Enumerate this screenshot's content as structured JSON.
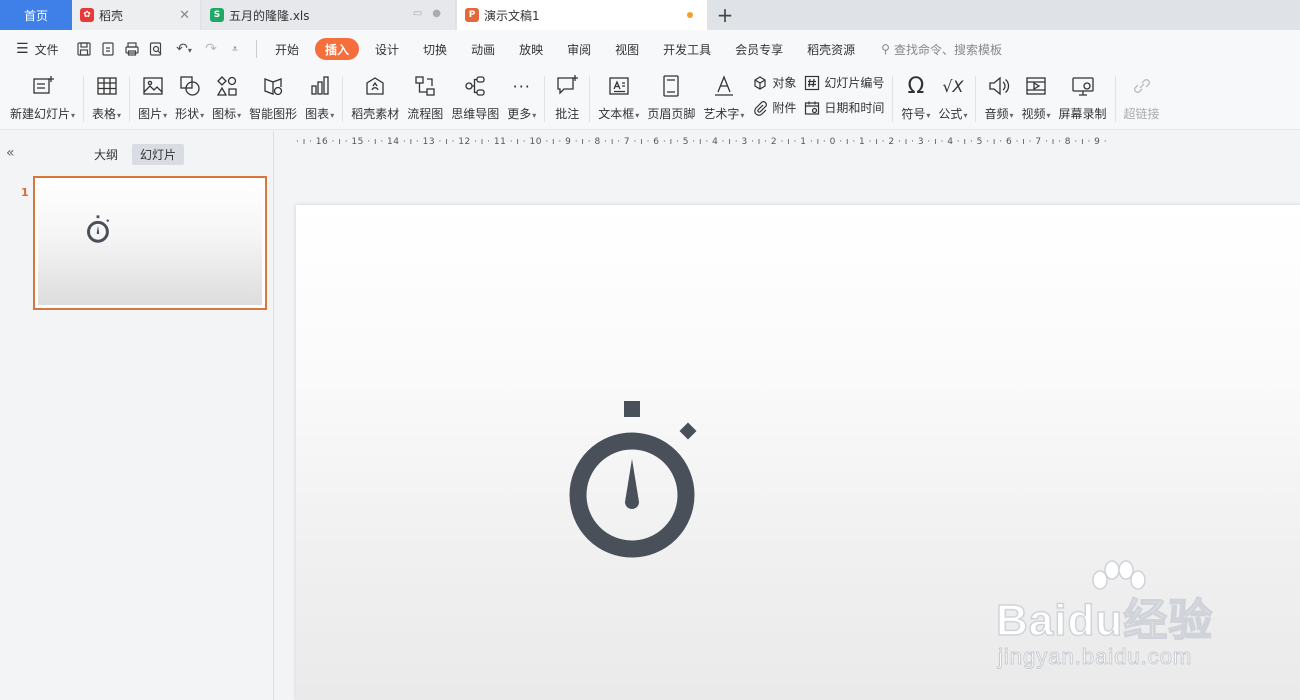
{
  "tabs": {
    "home": "首页",
    "daoke": "稻壳",
    "xls": "五月的隆隆.xls",
    "ppt": "演示文稿1",
    "add": "+"
  },
  "menu": {
    "file": "文件",
    "items": [
      "开始",
      "插入",
      "设计",
      "切换",
      "动画",
      "放映",
      "审阅",
      "视图",
      "开发工具",
      "会员专享",
      "稻壳资源"
    ],
    "active": "插入",
    "search": "查找命令、搜索模板"
  },
  "ribbon": {
    "new_slide": "新建幻灯片",
    "table": "表格",
    "picture": "图片",
    "shape": "形状",
    "icon": "图标",
    "smartart": "智能图形",
    "chart": "图表",
    "daoke_material": "稻壳素材",
    "flowchart": "流程图",
    "mindmap": "思维导图",
    "more": "更多",
    "comment": "批注",
    "textbox": "文本框",
    "header_footer": "页眉页脚",
    "wordart": "艺术字",
    "object": "对象",
    "attachment": "附件",
    "slide_number": "幻灯片编号",
    "datetime": "日期和时间",
    "symbol": "符号",
    "formula": "公式",
    "audio": "音频",
    "video": "视频",
    "screen_record": "屏幕录制",
    "hyperlink": "超链接"
  },
  "leftpanel": {
    "outline": "大纲",
    "slides": "幻灯片",
    "slide_number": "1"
  },
  "ruler": "· ı · 16 · ı · 15 · ı · 14 · ı · 13 · ı · 12 · ı · 11 · ı · 10 · ı · 9 · ı · 8 · ı · 7 · ı · 6 · ı · 5 · ı · 4 · ı · 3 · ı · 2 · ı · 1 · ı · 0 · ı · 1 · ı · 2 · ı · 3 · ı · 4 · ı · 5 · ı · 6 · ı · 7 · ı · 8 · ı · 9 ·",
  "watermark": {
    "logo": "Baidu经验",
    "url": "jingyan.baidu.com"
  },
  "colors": {
    "home_tab": "#3f7fe8",
    "active_menu": "#f56e3c",
    "selected_thumb": "#d8763c",
    "icon_dark": "#4a5059"
  }
}
